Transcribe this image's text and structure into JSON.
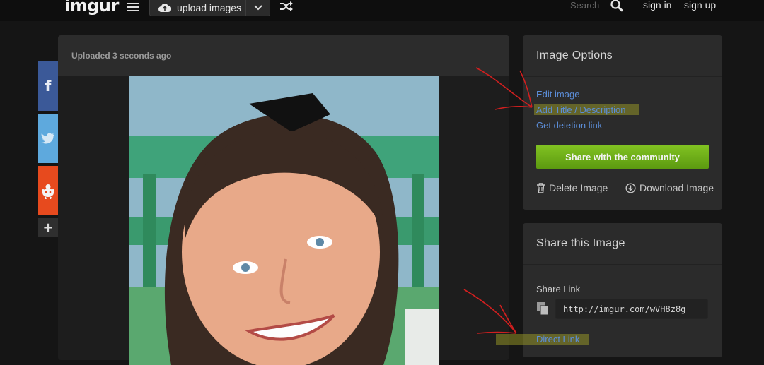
{
  "header": {
    "logo": "imgur",
    "upload_label": "upload images",
    "search_placeholder": "Search",
    "sign_in": "sign in",
    "sign_up": "sign up"
  },
  "social": {
    "facebook_glyph": "f",
    "more_glyph": "+"
  },
  "post": {
    "uploaded_text": "Uploaded 3 seconds ago"
  },
  "image_options": {
    "title": "Image Options",
    "links": [
      "Edit image",
      "Add Title / Description",
      "Get deletion link"
    ],
    "share_button": "Share with the community",
    "delete": "Delete Image",
    "download": "Download Image"
  },
  "share_image": {
    "title": "Share this Image",
    "share_link_label": "Share Link",
    "share_link_value": "http://imgur.com/wVH8z8g",
    "direct_link_label": "Direct Link"
  },
  "colors": {
    "accent_green": "#6fae17",
    "link_blue": "#5c8ed9",
    "annotation_red": "#d21f1f",
    "highlight_yellow": "#a8a82a"
  },
  "icons": [
    "hamburger-icon",
    "cloud-upload-icon",
    "chevron-down-icon",
    "shuffle-icon",
    "search-icon",
    "facebook-icon",
    "twitter-icon",
    "reddit-icon",
    "plus-icon",
    "trash-icon",
    "download-icon",
    "copy-icon"
  ]
}
